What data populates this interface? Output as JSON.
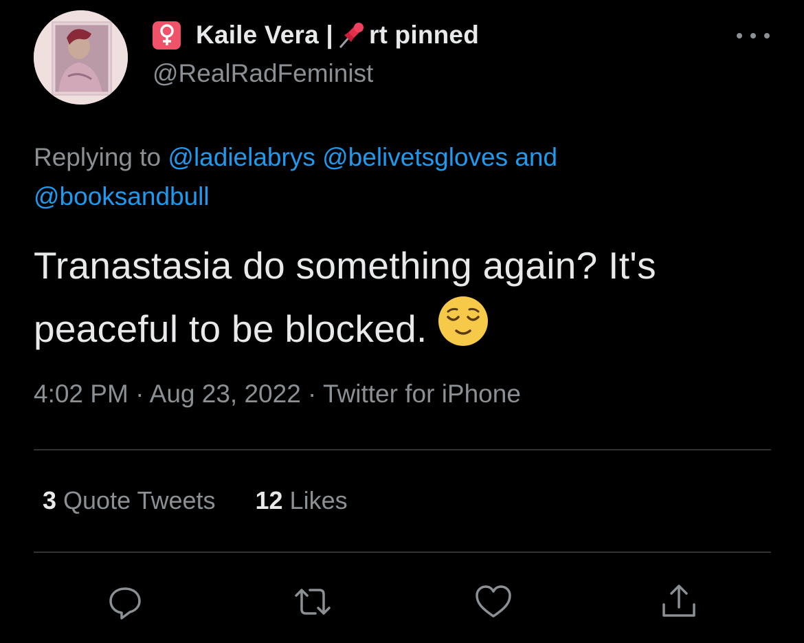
{
  "author": {
    "name_prefix": "Kaile Vera | ",
    "name_suffix": "rt pinned",
    "handle": "@RealRadFeminist",
    "name_emoji_1": "female-sign-icon",
    "name_emoji_2": "pushpin-icon"
  },
  "reply_context": {
    "label": "Replying to ",
    "mention_1": "@ladielabrys",
    "mention_2": "@belivetsgloves",
    "conjunction": "and",
    "mention_3": "@booksandbull"
  },
  "tweet": {
    "text": "Tranastasia do something again? It's peaceful to be blocked.",
    "emoji": "relieved-face-icon"
  },
  "meta": {
    "time": "4:02 PM",
    "separator_1": " · ",
    "date": "Aug 23, 2022",
    "separator_2": " · ",
    "source": "Twitter for iPhone"
  },
  "stats": {
    "quote_tweets_count": "3",
    "quote_tweets_label": "Quote Tweets",
    "likes_count": "12",
    "likes_label": "Likes"
  },
  "actions": [
    "reply-icon",
    "retweet-icon",
    "like-icon",
    "share-icon"
  ],
  "colors": {
    "background": "#000000",
    "text_primary": "#e7e9ea",
    "text_secondary": "#8b9095",
    "link": "#1d9bf0",
    "divider": "#2f3336"
  }
}
